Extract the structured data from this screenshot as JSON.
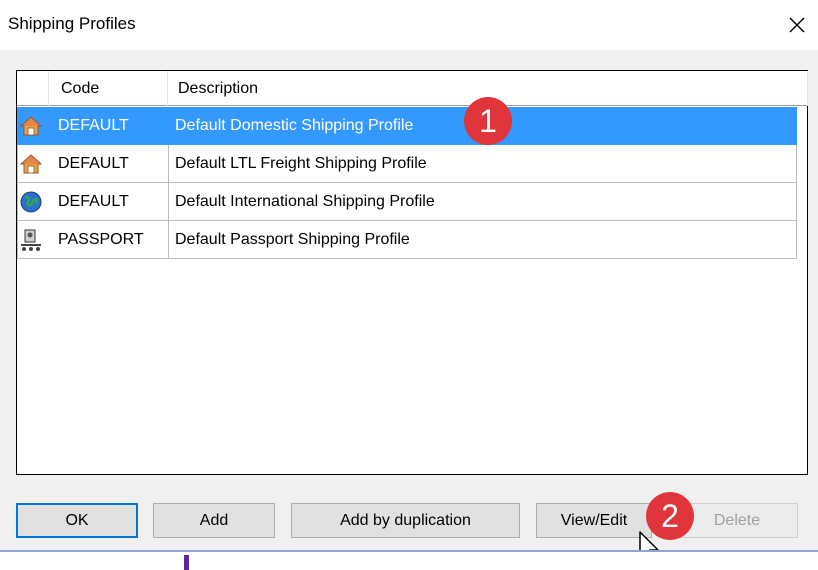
{
  "window": {
    "title": "Shipping Profiles",
    "close_label": "×"
  },
  "table": {
    "columns": [
      "Code",
      "Description"
    ],
    "rows": [
      {
        "code": "DEFAULT",
        "description": "Default Domestic Shipping Profile",
        "icon": "house-icon",
        "selected": true
      },
      {
        "code": "DEFAULT",
        "description": "Default LTL Freight Shipping Profile",
        "icon": "house-icon",
        "selected": false
      },
      {
        "code": "DEFAULT",
        "description": "Default International Shipping Profile",
        "icon": "globe-icon",
        "selected": false
      },
      {
        "code": "PASSPORT",
        "description": "Default Passport Shipping Profile",
        "icon": "passport-icon",
        "selected": false
      }
    ]
  },
  "buttons": {
    "ok": "OK",
    "add": "Add",
    "add_dup": "Add by duplication",
    "view_edit": "View/Edit",
    "delete": "Delete"
  },
  "annotations": {
    "one": "1",
    "two": "2"
  },
  "colors": {
    "selection": "#3399ff",
    "badge": "#e0353a",
    "focus": "#0078d7"
  }
}
